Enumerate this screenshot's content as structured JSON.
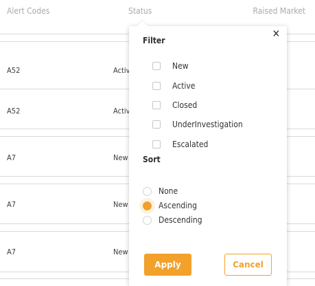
{
  "table": {
    "columns": [
      "Alert Codes",
      "Status",
      "Raised Market"
    ],
    "rows": [
      {
        "alert_code": "A52",
        "status": "Active"
      },
      {
        "alert_code": "A52",
        "status": "Active"
      },
      {
        "alert_code": "A7",
        "status": "New"
      },
      {
        "alert_code": "A7",
        "status": "New"
      },
      {
        "alert_code": "A7",
        "status": "New"
      }
    ]
  },
  "popup": {
    "close_glyph": "✕",
    "filter_title": "Filter",
    "filter_options": [
      "New",
      "Active",
      "Closed",
      "UnderInvestigation",
      "Escalated"
    ],
    "sort_title": "Sort",
    "sort_options": [
      "None",
      "Ascending",
      "Descending"
    ],
    "sort_selected": "Ascending",
    "apply_label": "Apply",
    "cancel_label": "Cancel"
  },
  "colors": {
    "accent": "#f2a12b",
    "header_text": "#a9aab0",
    "row_line": "#d8d9de"
  }
}
